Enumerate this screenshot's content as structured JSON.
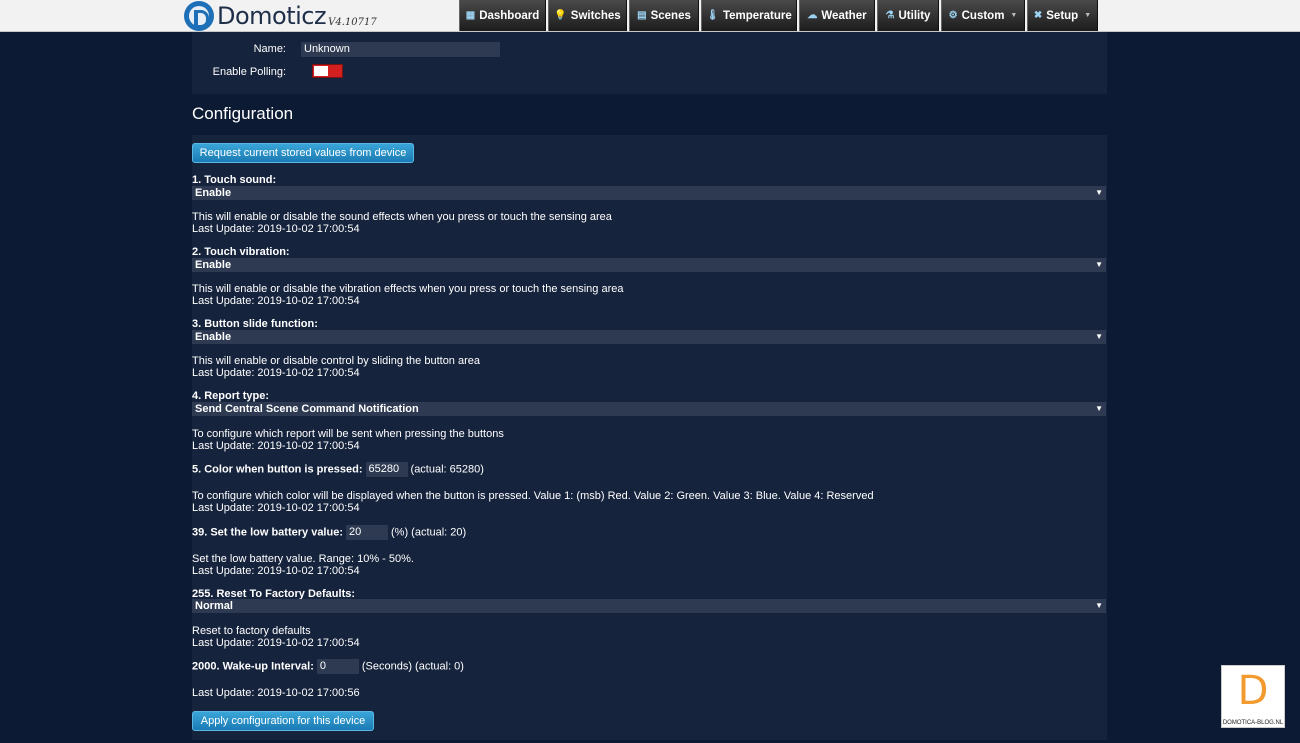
{
  "app": {
    "name": "Domoticz",
    "version": "V4.10717"
  },
  "nav": [
    {
      "label": "Dashboard",
      "icon": "dashboard-icon",
      "glyph": "▦"
    },
    {
      "label": "Switches",
      "icon": "bulb-icon",
      "glyph": "💡"
    },
    {
      "label": "Scenes",
      "icon": "scenes-icon",
      "glyph": "▤"
    },
    {
      "label": "Temperature",
      "icon": "thermometer-icon",
      "glyph": "🌡"
    },
    {
      "label": "Weather",
      "icon": "weather-icon",
      "glyph": "☁"
    },
    {
      "label": "Utility",
      "icon": "utility-icon",
      "glyph": "⚗"
    },
    {
      "label": "Custom",
      "icon": "gear-icon",
      "glyph": "⚙"
    },
    {
      "label": "Setup",
      "icon": "tools-icon",
      "glyph": "✖"
    }
  ],
  "device": {
    "name_label": "Name:",
    "name_value": "Unknown",
    "polling_label": "Enable Polling:",
    "polling_enabled": false
  },
  "config": {
    "title": "Configuration",
    "request_button": "Request current stored values from device",
    "apply_button": "Apply configuration for this device",
    "params": [
      {
        "title": "1. Touch sound:",
        "value": "Enable",
        "desc": "This will enable or disable the sound effects when you press or touch the sensing area",
        "last_update": "Last Update: 2019-10-02 17:00:54"
      },
      {
        "title": "2. Touch vibration:",
        "value": "Enable",
        "desc": "This will enable or disable the vibration effects when you press or touch the sensing area",
        "last_update": "Last Update: 2019-10-02 17:00:54"
      },
      {
        "title": "3. Button slide function:",
        "value": "Enable",
        "desc": "This will enable or disable control by sliding the button area",
        "last_update": "Last Update: 2019-10-02 17:00:54"
      },
      {
        "title": "4. Report type:",
        "value": "Send Central Scene Command Notification",
        "desc": "To configure which report will be sent when pressing the buttons",
        "last_update": "Last Update: 2019-10-02 17:00:54"
      },
      {
        "title": "5. Color when button is pressed:",
        "value": "65280",
        "suffix": "(actual: 65280)",
        "desc": "To configure which color will be displayed when the button is pressed. Value 1: (msb) Red. Value 2: Green. Value 3: Blue. Value 4: Reserved",
        "last_update": "Last Update: 2019-10-02 17:00:54"
      },
      {
        "title": "39. Set the low battery value:",
        "value": "20",
        "suffix": "(%) (actual: 20)",
        "desc": "Set the low battery value. Range: 10% - 50%.",
        "last_update": "Last Update: 2019-10-02 17:00:54"
      },
      {
        "title": "255. Reset To Factory Defaults:",
        "value": "Normal",
        "desc": "Reset to factory defaults",
        "last_update": "Last Update: 2019-10-02 17:00:54"
      },
      {
        "title": "2000. Wake-up Interval:",
        "value": "0",
        "suffix": "(Seconds) (actual: 0)",
        "last_update": "Last Update: 2019-10-02 17:00:56"
      }
    ]
  },
  "watermark": {
    "letter": "D",
    "text": "DOMOTICA-BLOG.NL"
  },
  "colors": {
    "background": "#0d1a33",
    "panel": "#16233d",
    "input": "#2d3a52",
    "button": "#2a8fc7",
    "toggle_off": "#d22020"
  }
}
